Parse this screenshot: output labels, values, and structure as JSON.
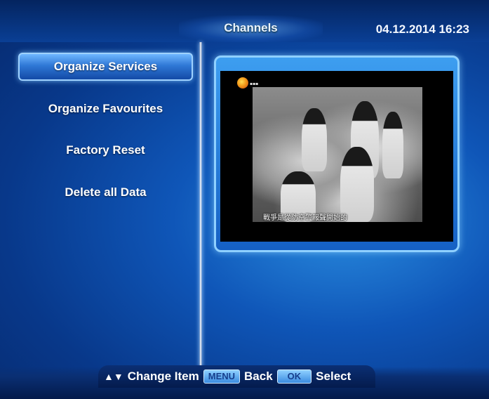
{
  "header": {
    "title": "Channels",
    "datetime": "04.12.2014  16:23"
  },
  "menu": {
    "items": [
      {
        "label": "Organize Services",
        "selected": true
      },
      {
        "label": "Organize Favourites",
        "selected": false
      },
      {
        "label": "Factory Reset",
        "selected": false
      },
      {
        "label": "Delete all Data",
        "selected": false
      }
    ]
  },
  "preview": {
    "subtitle": "戰爭是從防空警報聲開始的"
  },
  "footer": {
    "navigate_icon": "up-down-arrows",
    "change_item_label": "Change Item",
    "menu_key": "MENU",
    "back_label": "Back",
    "ok_key": "OK",
    "select_label": "Select"
  },
  "colors": {
    "background": "#0f56b8",
    "highlight": "#2f78d6",
    "frame_border": "#8fd0ff"
  }
}
